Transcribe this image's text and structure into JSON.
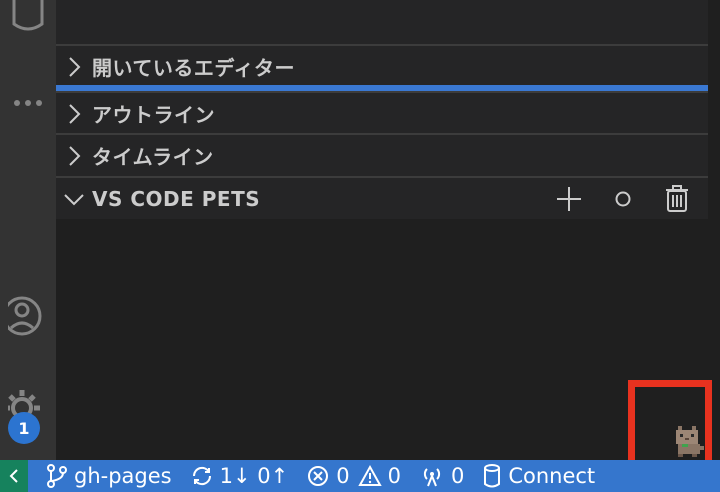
{
  "sidebar": {
    "sections": [
      {
        "label": "開いているエディター",
        "expanded": false
      },
      {
        "label": "アウトライン",
        "expanded": false
      },
      {
        "label": "タイムライン",
        "expanded": false
      },
      {
        "label": "VS CODE PETS",
        "expanded": true
      }
    ],
    "pets_actions": [
      "add-icon",
      "ball-icon",
      "trash-icon"
    ]
  },
  "activity_bar": {
    "badge": "1",
    "icons": [
      "database-icon",
      "more-icon",
      "account-icon",
      "gear-icon"
    ]
  },
  "statusbar": {
    "remote_icon": "remote-icon",
    "branch": "gh-pages",
    "sync": "1↓ 0↑",
    "errors": "0",
    "warnings": "0",
    "ports": "0",
    "connect": "Connect"
  },
  "colors": {
    "statusbar": "#3576cd",
    "focus": "#3a78d2",
    "highlight": "#e8321f",
    "badge": "#2c74d0"
  }
}
